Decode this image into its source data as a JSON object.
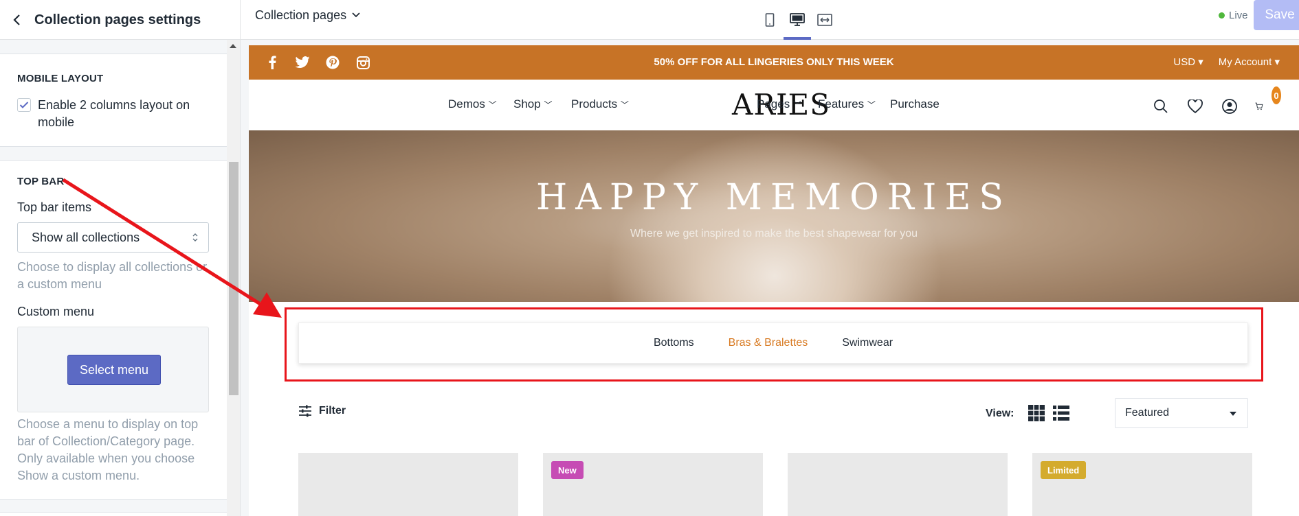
{
  "editor": {
    "panel_title": "Collection pages settings",
    "page_selector": "Collection pages",
    "live_label": "Live",
    "save_label": "Save"
  },
  "settings": {
    "mobile_layout": {
      "heading": "MOBILE LAYOUT",
      "checkbox_label": "Enable 2 columns layout on mobile",
      "checked": true
    },
    "top_bar": {
      "heading": "TOP BAR",
      "items_label": "Top bar items",
      "items_value": "Show all collections",
      "items_help": "Choose to display all collections or a custom menu",
      "custom_menu_label": "Custom menu",
      "select_menu_button": "Select menu",
      "custom_menu_help": "Choose a menu to display on top bar of Collection/Category page. Only available when you choose Show a custom menu."
    }
  },
  "store": {
    "announcement": "50% OFF FOR ALL LINGERIES ONLY THIS WEEK",
    "currency": "USD",
    "account": "My Account",
    "logo": "ARIES",
    "nav_left": [
      "Demos",
      "Shop",
      "Products"
    ],
    "nav_right": [
      "Pages",
      "Features",
      "Purchase"
    ],
    "cart_count": "0",
    "hero": {
      "title": "HAPPY MEMORIES",
      "subtitle": "Where we get inspired to make the best shapewear for you"
    },
    "collections": [
      "Bottoms",
      "Bras & Bralettes",
      "Swimwear"
    ],
    "active_collection": "Bras & Bralettes",
    "filter_label": "Filter",
    "view_label": "View:",
    "sort_value": "Featured",
    "badges": {
      "new": "New",
      "limited": "Limited"
    },
    "colors": {
      "announcement_bg": "#c77326",
      "accent": "#d87a22",
      "new_badge": "#c64cb4",
      "limited_badge": "#d4ab2e",
      "primary_button": "#5c6ac4",
      "highlight": "#e8151b"
    }
  }
}
